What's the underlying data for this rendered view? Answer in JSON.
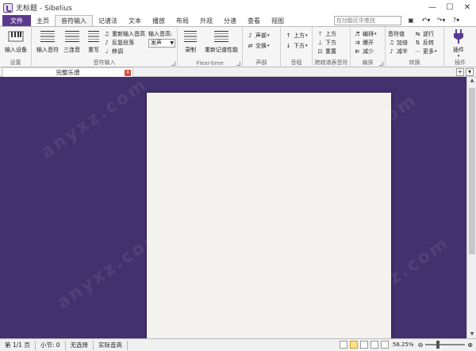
{
  "window": {
    "title": "无标题 - Sibelius",
    "minimize": "—",
    "maximize": "☐",
    "close": "✕"
  },
  "tabs": [
    "文件",
    "主页",
    "音符输入",
    "记谱法",
    "文本",
    "播放",
    "布局",
    "外观",
    "分谱",
    "查看",
    "视图"
  ],
  "active_tab": "音符输入",
  "search": {
    "placeholder": "在功能区中查找"
  },
  "quick_access": [
    "save",
    "undo",
    "redo",
    "help"
  ],
  "ribbon": {
    "setup": {
      "label": "设置",
      "input_devices": "输入设备"
    },
    "note_input": {
      "label": "音符输入",
      "input_notes": "输入音符",
      "triplets": "三连音",
      "rewrite": "重写",
      "reinput_pitch": "重新输入音高",
      "reverse_segment": "反复段落",
      "transpose": "移调",
      "input_pitch_label": "输入音高:",
      "input_pitch_value": "发声"
    },
    "flexi_time": {
      "label": "Flexi-time",
      "record": "录制",
      "renotate": "重新记谱性能"
    },
    "voices": {
      "label": "声部",
      "voice": "声部",
      "swap": "交换"
    },
    "intervals": {
      "label": "音程",
      "up": "上方",
      "down": "下方"
    },
    "cross_staff": {
      "label": "跨越谱表音符",
      "above": "上方",
      "below": "下方",
      "reset": "重置"
    },
    "edit": {
      "label": "编排",
      "arrange": "编排",
      "explode": "爆开",
      "reduce": "减少"
    },
    "transform": {
      "label": "转换",
      "pitch": "音符值",
      "invert": "加倍",
      "halve": "减半",
      "retrograde": "逆行",
      "reverse": "反转",
      "more": "更多"
    },
    "plugins": {
      "label": "插件",
      "plugins_btn": "插件"
    }
  },
  "document": {
    "tab_title": "完整乐谱"
  },
  "statusbar": {
    "page": "第 1/1 页",
    "bars": "小节: 0",
    "selection": "无选择",
    "pitch": "实际音高",
    "zoom": "56.25%"
  },
  "watermark": "anyxz.com",
  "colors": {
    "workspace": "#43306e",
    "file_tab": "#5b3a8e",
    "paper": "#f4f2ef"
  }
}
